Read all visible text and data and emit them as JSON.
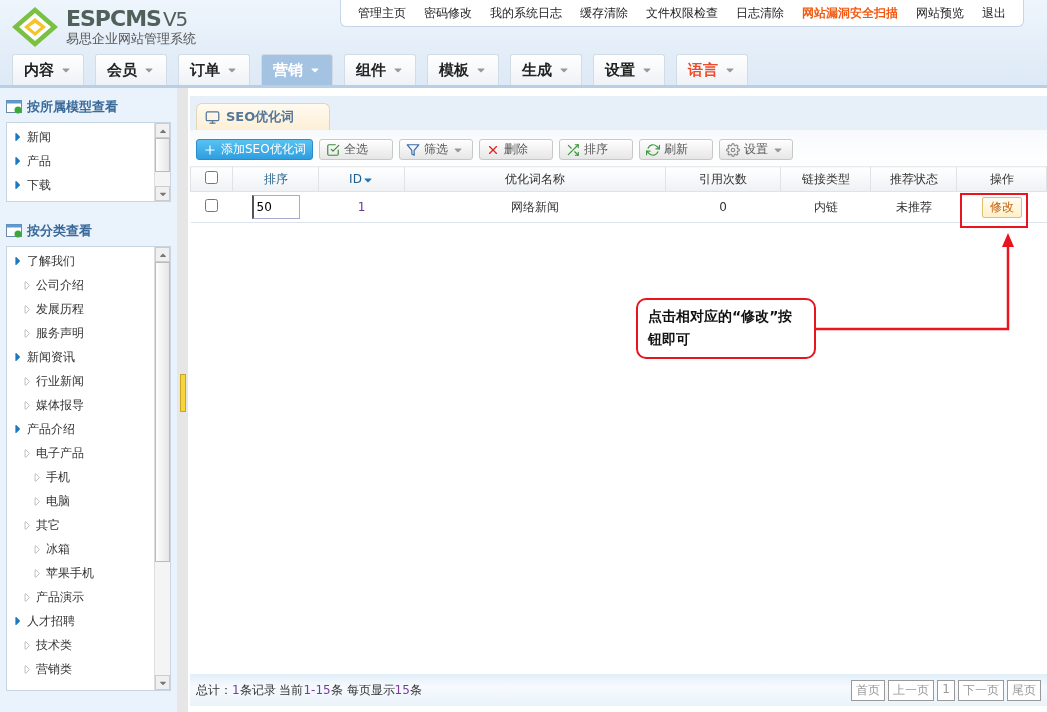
{
  "logo": {
    "name": "ESPCMS",
    "version": "V5",
    "subtitle": "易思企业网站管理系统"
  },
  "top_links": [
    {
      "label": "管理主页",
      "emphasis": false
    },
    {
      "label": "密码修改",
      "emphasis": false
    },
    {
      "label": "我的系统日志",
      "emphasis": false
    },
    {
      "label": "缓存清除",
      "emphasis": false
    },
    {
      "label": "文件权限检查",
      "emphasis": false
    },
    {
      "label": "日志清除",
      "emphasis": false
    },
    {
      "label": "网站漏洞安全扫描",
      "emphasis": true
    },
    {
      "label": "网站预览",
      "emphasis": false
    },
    {
      "label": "退出",
      "emphasis": false
    }
  ],
  "nav_tabs": [
    {
      "label": "内容",
      "selected": false,
      "emphasis": false
    },
    {
      "label": "会员",
      "selected": false,
      "emphasis": false
    },
    {
      "label": "订单",
      "selected": false,
      "emphasis": false
    },
    {
      "label": "营销",
      "selected": true,
      "emphasis": false
    },
    {
      "label": "组件",
      "selected": false,
      "emphasis": false
    },
    {
      "label": "模板",
      "selected": false,
      "emphasis": false
    },
    {
      "label": "生成",
      "selected": false,
      "emphasis": false
    },
    {
      "label": "设置",
      "selected": false,
      "emphasis": false
    },
    {
      "label": "语言",
      "selected": false,
      "emphasis": true
    }
  ],
  "sidebar": {
    "model_section": {
      "title": "按所属模型查看",
      "items": [
        {
          "label": "新闻"
        },
        {
          "label": "产品"
        },
        {
          "label": "下载"
        }
      ]
    },
    "category_section": {
      "title": "按分类查看",
      "items": [
        {
          "label": "了解我们",
          "children": [
            {
              "label": "公司介绍"
            },
            {
              "label": "发展历程"
            },
            {
              "label": "服务声明"
            }
          ]
        },
        {
          "label": "新闻资讯",
          "children": [
            {
              "label": "行业新闻"
            },
            {
              "label": "媒体报导"
            }
          ]
        },
        {
          "label": "产品介绍",
          "children": [
            {
              "label": "电子产品",
              "children": [
                {
                  "label": "手机"
                },
                {
                  "label": "电脑"
                }
              ]
            },
            {
              "label": "其它",
              "children": [
                {
                  "label": "冰箱"
                },
                {
                  "label": "苹果手机"
                }
              ]
            },
            {
              "label": "产品演示"
            }
          ]
        },
        {
          "label": "人才招聘",
          "children": [
            {
              "label": "技术类"
            },
            {
              "label": "营销类"
            }
          ]
        }
      ]
    }
  },
  "page_tab": {
    "label": "SEO优化词"
  },
  "toolbar": [
    {
      "label": "添加SEO优化词",
      "kind": "primary",
      "dropdown": false
    },
    {
      "label": "全选",
      "kind": "normal",
      "dropdown": false
    },
    {
      "label": "筛选",
      "kind": "normal",
      "dropdown": true
    },
    {
      "label": "删除",
      "kind": "normal",
      "dropdown": false
    },
    {
      "label": "排序",
      "kind": "normal",
      "dropdown": false
    },
    {
      "label": "刷新",
      "kind": "normal",
      "dropdown": false
    },
    {
      "label": "设置",
      "kind": "normal",
      "dropdown": true
    }
  ],
  "table": {
    "select_all_checked": false,
    "columns": [
      {
        "label": "排序",
        "sortable": true,
        "sorted": false
      },
      {
        "label": "ID",
        "sortable": true,
        "sorted": true
      },
      {
        "label": "优化词名称",
        "sortable": false,
        "sorted": false
      },
      {
        "label": "引用次数",
        "sortable": false,
        "sorted": false
      },
      {
        "label": "链接类型",
        "sortable": false,
        "sorted": false
      },
      {
        "label": "推荐状态",
        "sortable": false,
        "sorted": false
      },
      {
        "label": "操作",
        "sortable": false,
        "sorted": false
      }
    ],
    "rows": [
      {
        "checked": false,
        "order": "50",
        "id": "1",
        "name": "网络新闻",
        "references": "0",
        "link_type": "内链",
        "status": "未推荐",
        "action": "修改"
      }
    ]
  },
  "callout": {
    "text": "点击相对应的“修改”按钮即可"
  },
  "footer": {
    "summary": "总计：**1**条记录 当前**1-15**条 每页显示**15**条",
    "pages": [
      "首页",
      "上一页",
      "1",
      "下一页",
      "尾页"
    ]
  }
}
